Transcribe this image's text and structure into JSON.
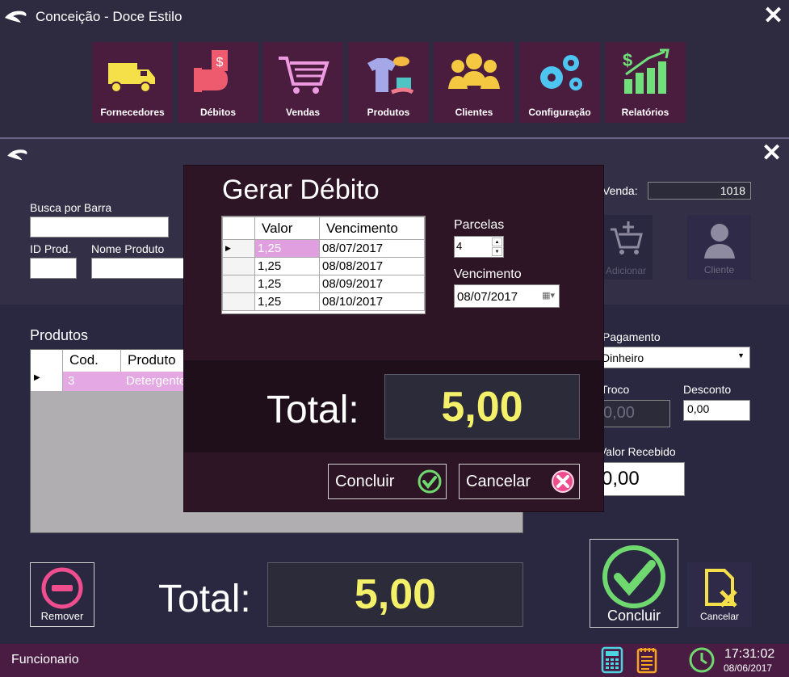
{
  "window": {
    "title": "Conceição - Doce Estilo"
  },
  "nav": [
    {
      "label": "Fornecedores",
      "icon": "truck-icon"
    },
    {
      "label": "Débitos",
      "icon": "money-hand-icon"
    },
    {
      "label": "Vendas",
      "icon": "shopping-cart-icon"
    },
    {
      "label": "Produtos",
      "icon": "clothes-icon"
    },
    {
      "label": "Clientes",
      "icon": "users-icon"
    },
    {
      "label": "Configuração",
      "icon": "gears-icon"
    },
    {
      "label": "Relatórios",
      "icon": "chart-growth-icon"
    }
  ],
  "sale": {
    "venda_label": "Venda:",
    "venda_value": "1018",
    "busca_label": "Busca por Barra",
    "busca_value": "",
    "id_prod_label": "ID Prod.",
    "id_prod_value": "",
    "nome_produto_label": "Nome Produto",
    "nome_produto_value": "",
    "adicionar_label": "Adicionar",
    "cliente_label": "Cliente",
    "produtos_label": "Produtos",
    "grid_headers": [
      "Cod.",
      "Produto"
    ],
    "grid_rows": [
      {
        "cod": "3",
        "produto": "Detergente"
      }
    ],
    "pagamento_label": "Pagamento",
    "pagamento_value": "Dinheiro",
    "troco_label": "Troco",
    "troco_value": "0,00",
    "desconto_label": "Desconto",
    "desconto_value": "0,00",
    "valor_recebido_label": "Valor Recebido",
    "valor_recebido_value": "0,00",
    "remover_label": "Remover",
    "total_label": "Total:",
    "total_value": "5,00",
    "concluir_label": "Concluir",
    "cancelar_label": "Cancelar"
  },
  "dialog": {
    "title": "Gerar Débito",
    "headers": [
      "Valor",
      "Vencimento"
    ],
    "rows": [
      {
        "valor": "1,25",
        "vencimento": "08/07/2017"
      },
      {
        "valor": "1,25",
        "vencimento": "08/08/2017"
      },
      {
        "valor": "1,25",
        "vencimento": "08/09/2017"
      },
      {
        "valor": "1,25",
        "vencimento": "08/10/2017"
      }
    ],
    "parcelas_label": "Parcelas",
    "parcelas_value": "4",
    "vencimento_label": "Vencimento",
    "vencimento_value": "08/07/2017",
    "total_label": "Total:",
    "total_value": "5,00",
    "concluir_label": "Concluir",
    "cancelar_label": "Cancelar"
  },
  "footer": {
    "user": "Funcionario",
    "time": "17:31:02",
    "date": "08/06/2017"
  },
  "colors": {
    "nav_bg": "#4a1c3e",
    "highlight_pink": "#e0a0e0",
    "total_yellow": "#f5f06a",
    "check_green": "#6fd86f",
    "cancel_pink": "#ee4e8e"
  }
}
